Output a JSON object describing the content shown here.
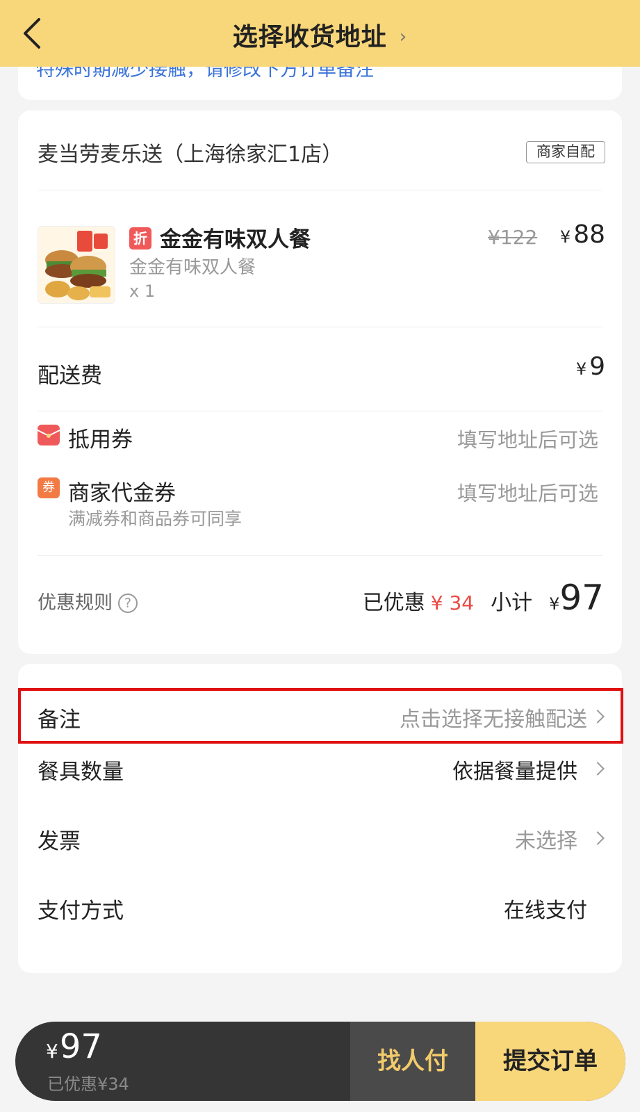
{
  "header": {
    "title": "选择收货地址",
    "chevron": "›",
    "back_icon": "chevron-left-icon"
  },
  "notice": {
    "text": "特殊时期减少接触，请修改下方订单备注"
  },
  "store": {
    "name": "麦当劳麦乐送（上海徐家汇1店）",
    "delivery_badge": "商家自配"
  },
  "item": {
    "tag": "折",
    "name": "金金有味双人餐",
    "subtitle": "金金有味双人餐",
    "quantity": "x 1",
    "original_price": "¥122",
    "currency": "¥",
    "price": "88"
  },
  "fees": {
    "delivery_label": "配送费",
    "currency": "¥",
    "delivery_value": "9"
  },
  "coupons": {
    "voucher_label": "抵用券",
    "voucher_value": "填写地址后可选",
    "merchant_label": "商家代金券",
    "merchant_value": "填写地址后可选",
    "merchant_sub": "满减券和商品券可同享",
    "voucher_icon_color": "#f0595a",
    "merchant_icon_color": "#f27a45",
    "merchant_icon_text": "券"
  },
  "summary": {
    "rules_label": "优惠规则",
    "rules_icon": "?",
    "discounted_label": "已优惠",
    "discounted_value": "¥ 34",
    "subtotal_label": "小计",
    "currency": "¥",
    "subtotal_value": "97"
  },
  "extras": {
    "remark_label": "备注",
    "remark_value": "点击选择无接触配送",
    "tableware_label": "餐具数量",
    "tableware_value": "依据餐量提供",
    "invoice_label": "发票",
    "invoice_value": "未选择",
    "payment_label": "支付方式",
    "payment_value": "在线支付"
  },
  "bottom_bar": {
    "currency": "¥",
    "total": "97",
    "discount_text": "已优惠¥34",
    "find_payer_label": "找人付",
    "submit_label": "提交订单"
  },
  "colors": {
    "brand_yellow": "#f8d67a",
    "accent_red": "#e94a43",
    "link_blue": "#3a73d8",
    "highlight_box": "#e01010"
  }
}
